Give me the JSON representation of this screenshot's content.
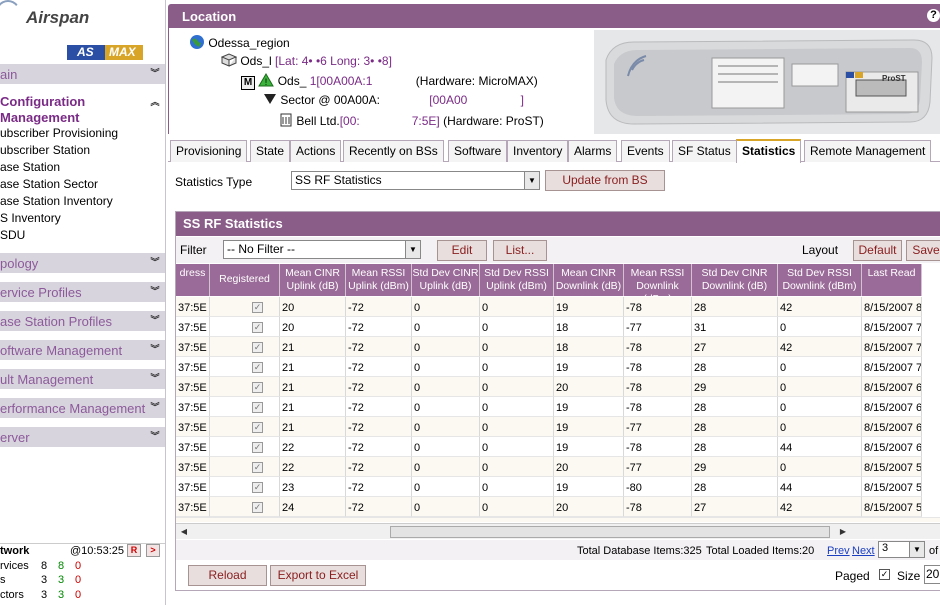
{
  "sidebar": {
    "logo_text": "Airspan",
    "asmax_left": "AS",
    "asmax_right": "MAX",
    "sections": [
      {
        "label": "ain"
      },
      {
        "label": "Configuration Management"
      },
      {
        "label": "pology"
      },
      {
        "label": "ervice Profiles"
      },
      {
        "label": "ase Station Profiles"
      },
      {
        "label": "oftware Management"
      },
      {
        "label": "ult Management"
      },
      {
        "label": "erformance Management"
      },
      {
        "label": "erver"
      }
    ],
    "config_items": [
      "ubscriber Provisioning",
      "ubscriber Station",
      "ase Station",
      "ase Station Sector",
      "ase Station Inventory",
      "S Inventory",
      "SDU"
    ],
    "network": {
      "title": "twork",
      "time": "@10:53:25",
      "r_label": "R",
      "arrow_label": ">",
      "rows": [
        {
          "label": "rvices",
          "a": "8",
          "b": "8",
          "c": "0"
        },
        {
          "label": "s",
          "a": "3",
          "b": "3",
          "c": "0"
        },
        {
          "label": "ctors",
          "a": "3",
          "b": "3",
          "c": "0"
        }
      ]
    }
  },
  "location": {
    "title": "Location",
    "help": "?",
    "tree": {
      "region": "Odessa_region",
      "site_name": "Ods_l",
      "site_coords": "[Lat: 4• •6 Long: 3• •8]",
      "bs_name": "Ods_",
      "bs_mac": "1[00A00A:1",
      "bs_hw": "(Hardware: MicroMAX)",
      "sector_name": "Sector @ 00A00A:",
      "sector_mac": "[00A00",
      "sector_mac_end": "]",
      "ss_name": "Bell Ltd.",
      "ss_mac": "[00:",
      "ss_mac_end": "7:5E]",
      "ss_hw": "(Hardware: ProST)",
      "m_badge": "M"
    },
    "device_label": "ProST"
  },
  "tabs": [
    "Provisioning",
    "State",
    "Actions",
    "Recently on BSs",
    "Software",
    "Inventory",
    "Alarms",
    "Events",
    "SF Status",
    "Statistics",
    "Remote Management"
  ],
  "active_tab": "Statistics",
  "stats": {
    "type_label": "Statistics Type",
    "type_value": "SS RF Statistics",
    "update_button": "Update from BS"
  },
  "panel": {
    "title": "SS RF Statistics",
    "filter_label": "Filter",
    "filter_value": "-- No Filter --",
    "edit_button": "Edit",
    "list_button": "List...",
    "layout_label": "Layout",
    "default_button": "Default",
    "save_button": "Save",
    "columns": [
      "dress",
      "Registered",
      "Mean CINR Uplink (dB)",
      "Mean RSSI Uplink (dBm)",
      "Std Dev CINR Uplink (dB)",
      "Std Dev RSSI Uplink (dBm)",
      "Mean CINR Downlink (dB)",
      "Mean RSSI Downlink (dBm)",
      "Std Dev CINR Downlink (dB)",
      "Std Dev RSSI Downlink (dBm)",
      "Last Read"
    ],
    "rows": [
      [
        "37:5E",
        "",
        "20",
        "-72",
        "0",
        "0",
        "19",
        "-78",
        "28",
        "42",
        "8/15/2007 8:"
      ],
      [
        "37:5E",
        "",
        "20",
        "-72",
        "0",
        "0",
        "18",
        "-77",
        "31",
        "0",
        "8/15/2007 7:"
      ],
      [
        "37:5E",
        "",
        "21",
        "-72",
        "0",
        "0",
        "18",
        "-78",
        "27",
        "42",
        "8/15/2007 7:"
      ],
      [
        "37:5E",
        "",
        "21",
        "-72",
        "0",
        "0",
        "19",
        "-78",
        "28",
        "0",
        "8/15/2007 7:"
      ],
      [
        "37:5E",
        "",
        "21",
        "-72",
        "0",
        "0",
        "20",
        "-78",
        "29",
        "0",
        "8/15/2007 6:"
      ],
      [
        "37:5E",
        "",
        "21",
        "-72",
        "0",
        "0",
        "19",
        "-78",
        "28",
        "0",
        "8/15/2007 6:"
      ],
      [
        "37:5E",
        "",
        "21",
        "-72",
        "0",
        "0",
        "19",
        "-77",
        "28",
        "0",
        "8/15/2007 6:"
      ],
      [
        "37:5E",
        "",
        "22",
        "-72",
        "0",
        "0",
        "19",
        "-78",
        "28",
        "44",
        "8/15/2007 6:"
      ],
      [
        "37:5E",
        "",
        "22",
        "-72",
        "0",
        "0",
        "20",
        "-77",
        "29",
        "0",
        "8/15/2007 5:"
      ],
      [
        "37:5E",
        "",
        "23",
        "-72",
        "0",
        "0",
        "19",
        "-80",
        "28",
        "44",
        "8/15/2007 5:"
      ],
      [
        "37:5E",
        "",
        "24",
        "-72",
        "0",
        "0",
        "20",
        "-78",
        "27",
        "42",
        "8/15/2007 5:"
      ]
    ],
    "total_db": "Total Database Items:325",
    "total_loaded": "Total Loaded Items:20",
    "prev": "Prev",
    "next": "Next",
    "page": "3",
    "of_label": "of",
    "reload_button": "Reload",
    "export_button": "Export to Excel",
    "paged_label": "Paged",
    "size_label": "Size",
    "size_value": "20"
  }
}
